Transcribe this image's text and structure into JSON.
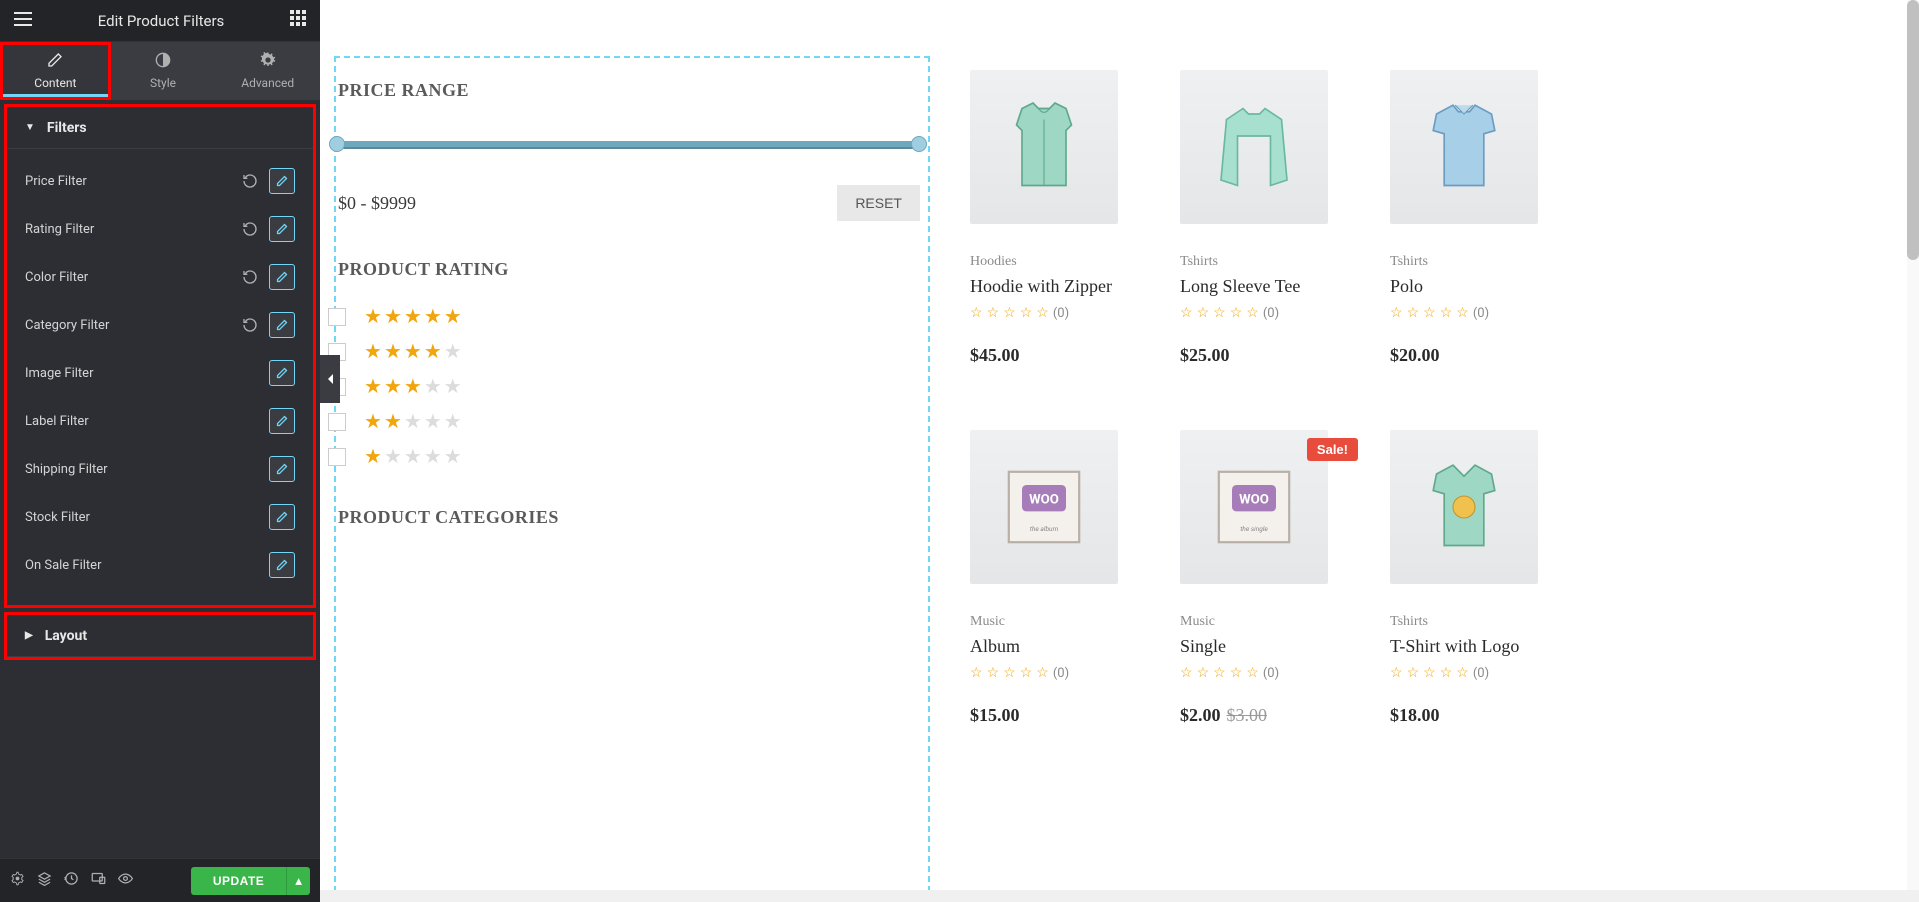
{
  "header": {
    "title": "Edit Product Filters"
  },
  "tabs": [
    {
      "label": "Content",
      "active": true
    },
    {
      "label": "Style",
      "active": false
    },
    {
      "label": "Advanced",
      "active": false
    }
  ],
  "accordion": {
    "filters_title": "Filters",
    "layout_title": "Layout",
    "items": [
      {
        "label": "Price Filter",
        "has_reset": true
      },
      {
        "label": "Rating Filter",
        "has_reset": true
      },
      {
        "label": "Color Filter",
        "has_reset": true
      },
      {
        "label": "Category Filter",
        "has_reset": true
      },
      {
        "label": "Image Filter",
        "has_reset": false
      },
      {
        "label": "Label Filter",
        "has_reset": false
      },
      {
        "label": "Shipping Filter",
        "has_reset": false
      },
      {
        "label": "Stock Filter",
        "has_reset": false
      },
      {
        "label": "On Sale Filter",
        "has_reset": false
      }
    ]
  },
  "footer": {
    "update_label": "UPDATE"
  },
  "filter_panel": {
    "price_title": "PRICE RANGE",
    "price_value": "$0 - $9999",
    "reset_label": "RESET",
    "rating_title": "PRODUCT RATING",
    "ratings": [
      5,
      4,
      3,
      2,
      1
    ],
    "categories_title": "PRODUCT CATEGORIES"
  },
  "products": [
    {
      "cat": "Hoodies",
      "name": "Hoodie with Zipper",
      "count": "(0)",
      "price": "$45.00",
      "sale": false,
      "old_price": ""
    },
    {
      "cat": "Tshirts",
      "name": "Long Sleeve Tee",
      "count": "(0)",
      "price": "$25.00",
      "sale": false,
      "old_price": ""
    },
    {
      "cat": "Tshirts",
      "name": "Polo",
      "count": "(0)",
      "price": "$20.00",
      "sale": false,
      "old_price": ""
    },
    {
      "cat": "Music",
      "name": "Album",
      "count": "(0)",
      "price": "$15.00",
      "sale": false,
      "old_price": ""
    },
    {
      "cat": "Music",
      "name": "Single",
      "count": "(0)",
      "price": "$2.00",
      "sale": true,
      "old_price": "$3.00",
      "sale_label": "Sale!"
    },
    {
      "cat": "Tshirts",
      "name": "T-Shirt with Logo",
      "count": "(0)",
      "price": "$18.00",
      "sale": false,
      "old_price": ""
    }
  ]
}
